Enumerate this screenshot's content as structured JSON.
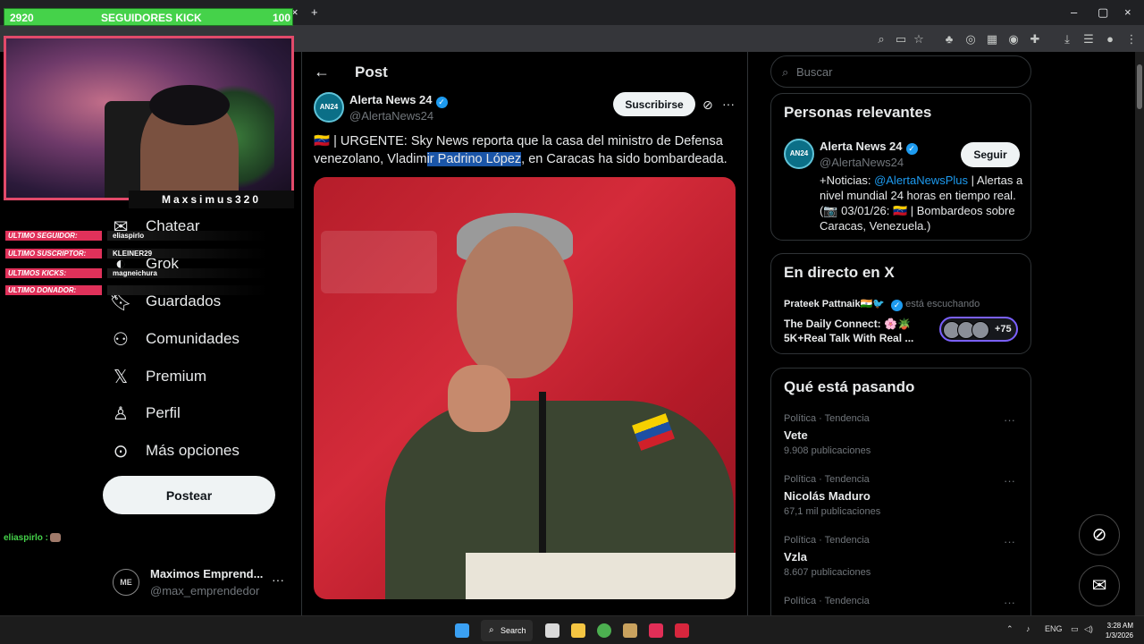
{
  "overlay": {
    "followers": {
      "count": "2920",
      "label": "SEGUIDORES KICK",
      "goal": "100"
    },
    "channel_name": "Maxsimus320",
    "rows": [
      {
        "label": "ULTIMO SEGUIDOR:",
        "value": "eliaspirlo"
      },
      {
        "label": "ULTIMO SUSCRIPTOR:",
        "value": "KLEINER29"
      },
      {
        "label": "ULTIMOS KICKS:",
        "value": "magneichura"
      },
      {
        "label": "ULTIMO DONADOR:",
        "value": ""
      }
    ],
    "chat": "eliaspirlo :"
  },
  "nav": {
    "items": [
      {
        "label": "Chatear",
        "icon": "mail-icon"
      },
      {
        "label": "Grok",
        "icon": "grok-icon"
      },
      {
        "label": "Guardados",
        "icon": "bookmark-icon"
      },
      {
        "label": "Comunidades",
        "icon": "communities-icon"
      },
      {
        "label": "Premium",
        "icon": "x-logo-icon"
      },
      {
        "label": "Perfil",
        "icon": "person-icon"
      },
      {
        "label": "Más opciones",
        "icon": "more-circle-icon"
      }
    ],
    "post_button": "Postear",
    "account": {
      "name": "Maximos Emprend...",
      "handle": "@max_emprendedor",
      "avatar_text": "ME"
    }
  },
  "post": {
    "header_title": "Post",
    "author": {
      "name": "Alerta News 24",
      "handle": "@AlertaNews24",
      "avatar_text": "Alerta News24"
    },
    "subscribe_label": "Suscribirse",
    "text_before": "🇻🇪 | URGENTE: Sky News reporta que la casa del ministro de Defensa venezolano, Vladim",
    "text_highlight": "ir Padrino López",
    "text_after": ", en Caracas ha sido bombardeada."
  },
  "sidebar": {
    "search_placeholder": "Buscar",
    "relevant": {
      "title": "Personas relevantes",
      "name": "Alerta News 24",
      "handle": "@AlertaNews24",
      "follow_label": "Seguir",
      "bio_prefix": "+Noticias: ",
      "bio_link": "@AlertaNewsPlus",
      "bio_rest": " | Alertas a nivel mundial 24 horas en tiempo real. (📷 03/01/26: 🇻🇪 | Bombardeos sobre Caracas, Venezuela.)"
    },
    "live": {
      "title": "En directo en X",
      "user": "Prateek Pattnaik🇮🇳🐦",
      "status": "está escuchando",
      "space_title": "The Daily Connect: 🌸🪴 5K+Real Talk With Real ...",
      "listeners": "+75"
    },
    "trending": {
      "title": "Qué está pasando",
      "items": [
        {
          "category": "Política · Tendencia",
          "title": "Vete",
          "count": "9.908 publicaciones"
        },
        {
          "category": "Política · Tendencia",
          "title": "Nicolás Maduro",
          "count": "67,1 mil publicaciones"
        },
        {
          "category": "Política · Tendencia",
          "title": "Vzla",
          "count": "8.607 publicaciones"
        },
        {
          "category": "Política · Tendencia",
          "title": "",
          "count": ""
        }
      ]
    }
  },
  "taskbar": {
    "search_label": "Search",
    "lang": "ENG",
    "time": "3:28 AM",
    "date": "1/3/2026"
  },
  "colors": {
    "accent": "#1d9bf0",
    "overlay_green": "#45d24a",
    "overlay_pink": "#e0315a",
    "highlight": "#1a55a8"
  }
}
